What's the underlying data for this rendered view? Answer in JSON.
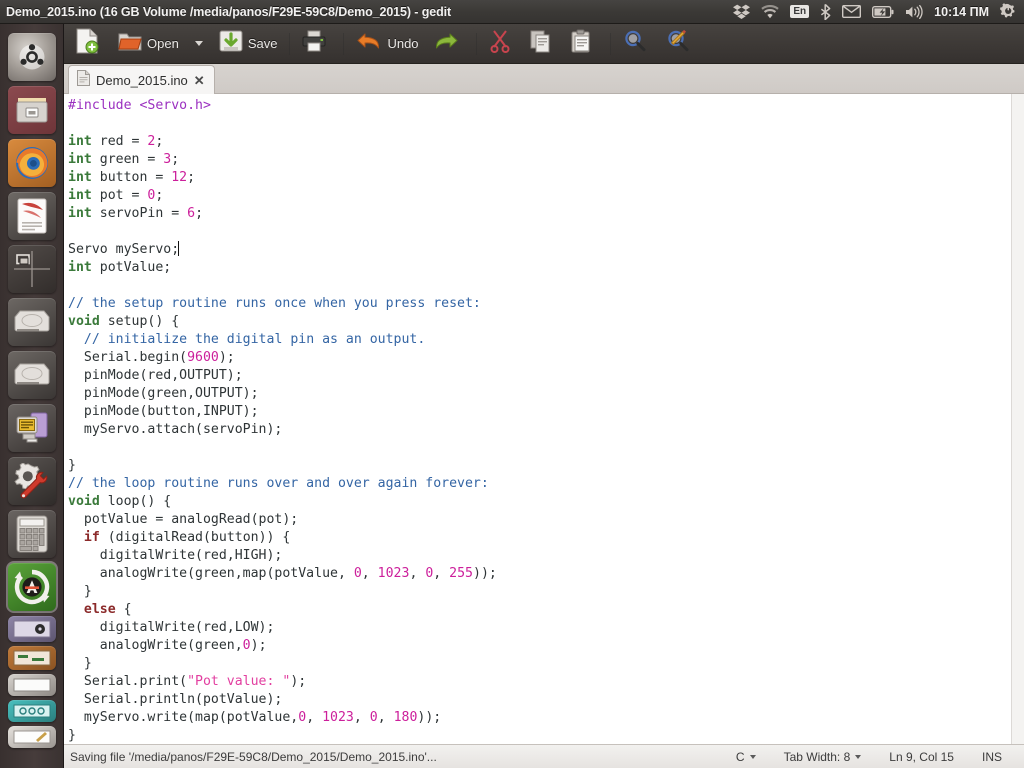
{
  "window": {
    "title": "Demo_2015.ino (16 GB Volume /media/panos/F29E-59C8/Demo_2015) - gedit"
  },
  "tray": {
    "keyboard_layout": "En",
    "clock": "10:14 ПМ",
    "icons": [
      "dropbox-icon",
      "wifi-icon",
      "keyboard-layout-indicator",
      "bluetooth-icon",
      "mail-icon",
      "battery-icon",
      "volume-icon",
      "system-menu-icon"
    ]
  },
  "launcher": {
    "items": [
      {
        "name": "ubuntu-dash",
        "label": "Dash home",
        "running": false,
        "active": false
      },
      {
        "name": "files",
        "label": "Files",
        "running": true,
        "active": false
      },
      {
        "name": "firefox",
        "label": "Firefox Web Browser",
        "running": true,
        "active": false
      },
      {
        "name": "libreoffice-writer",
        "label": "LibreOffice Writer",
        "running": false,
        "active": false
      },
      {
        "name": "workspace-switcher",
        "label": "Workspace Switcher",
        "running": false,
        "active": false
      },
      {
        "name": "disk-drive",
        "label": "Volume",
        "running": false,
        "active": false
      },
      {
        "name": "disk-drive-2",
        "label": "16 GB Volume",
        "running": false,
        "active": false
      },
      {
        "name": "software-center",
        "label": "Ubuntu Software Center",
        "running": false,
        "active": false
      },
      {
        "name": "system-settings",
        "label": "System Settings",
        "running": false,
        "active": false
      },
      {
        "name": "calculator",
        "label": "Calculator",
        "running": false,
        "active": false
      },
      {
        "name": "software-updater",
        "label": "Software Updater",
        "running": true,
        "active": true
      }
    ]
  },
  "toolbar": {
    "new_label": "",
    "open_label": "Open",
    "save_label": "Save",
    "print_label": "",
    "undo_label": "Undo",
    "redo_label": "",
    "cut_label": "",
    "copy_label": "",
    "paste_label": "",
    "find_label": "",
    "replace_label": ""
  },
  "tabs": [
    {
      "label": "Demo_2015.ino",
      "close": "✕",
      "active": true
    }
  ],
  "editor": {
    "cursor_line": 9,
    "cursor_col": 15,
    "lines": [
      [
        {
          "t": "#include <Servo.h>",
          "c": "pre"
        }
      ],
      [],
      [
        {
          "t": "int",
          "c": "kw"
        },
        {
          "t": " red = "
        },
        {
          "t": "2",
          "c": "num"
        },
        {
          "t": ";"
        }
      ],
      [
        {
          "t": "int",
          "c": "kw"
        },
        {
          "t": " green = "
        },
        {
          "t": "3",
          "c": "num"
        },
        {
          "t": ";"
        }
      ],
      [
        {
          "t": "int",
          "c": "kw"
        },
        {
          "t": " button = "
        },
        {
          "t": "12",
          "c": "num"
        },
        {
          "t": ";"
        }
      ],
      [
        {
          "t": "int",
          "c": "kw"
        },
        {
          "t": " pot = "
        },
        {
          "t": "0",
          "c": "num"
        },
        {
          "t": ";"
        }
      ],
      [
        {
          "t": "int",
          "c": "kw"
        },
        {
          "t": " servoPin = "
        },
        {
          "t": "6",
          "c": "num"
        },
        {
          "t": ";"
        }
      ],
      [],
      [
        {
          "t": "Servo myServo;"
        },
        {
          "t": "",
          "c": "caret"
        }
      ],
      [
        {
          "t": "int",
          "c": "kw"
        },
        {
          "t": " potValue;"
        }
      ],
      [],
      [
        {
          "t": "// the setup routine runs once when you press reset:",
          "c": "cmt"
        }
      ],
      [
        {
          "t": "void",
          "c": "kw"
        },
        {
          "t": " setup() {"
        }
      ],
      [
        {
          "t": "  "
        },
        {
          "t": "// initialize the digital pin as an output.",
          "c": "cmt"
        }
      ],
      [
        {
          "t": "  Serial.begin("
        },
        {
          "t": "9600",
          "c": "num"
        },
        {
          "t": ");"
        }
      ],
      [
        {
          "t": "  pinMode(red,OUTPUT);"
        }
      ],
      [
        {
          "t": "  pinMode(green,OUTPUT);"
        }
      ],
      [
        {
          "t": "  pinMode(button,INPUT);"
        }
      ],
      [
        {
          "t": "  myServo.attach(servoPin);"
        }
      ],
      [],
      [
        {
          "t": "}"
        }
      ],
      [
        {
          "t": "// the loop routine runs over and over again forever:",
          "c": "cmt"
        }
      ],
      [
        {
          "t": "void",
          "c": "kw"
        },
        {
          "t": " loop() {"
        }
      ],
      [
        {
          "t": "  potValue = analogRead(pot);"
        }
      ],
      [
        {
          "t": "  "
        },
        {
          "t": "if",
          "c": "kw2"
        },
        {
          "t": " (digitalRead(button)) {"
        }
      ],
      [
        {
          "t": "    digitalWrite(red,HIGH);"
        }
      ],
      [
        {
          "t": "    analogWrite(green,map(potValue, "
        },
        {
          "t": "0",
          "c": "num"
        },
        {
          "t": ", "
        },
        {
          "t": "1023",
          "c": "num"
        },
        {
          "t": ", "
        },
        {
          "t": "0",
          "c": "num"
        },
        {
          "t": ", "
        },
        {
          "t": "255",
          "c": "num"
        },
        {
          "t": "));"
        }
      ],
      [
        {
          "t": "  }"
        }
      ],
      [
        {
          "t": "  "
        },
        {
          "t": "else",
          "c": "kw2"
        },
        {
          "t": " {"
        }
      ],
      [
        {
          "t": "    digitalWrite(red,LOW);"
        }
      ],
      [
        {
          "t": "    analogWrite(green,"
        },
        {
          "t": "0",
          "c": "num"
        },
        {
          "t": ");"
        }
      ],
      [
        {
          "t": "  }"
        }
      ],
      [
        {
          "t": "  Serial.print("
        },
        {
          "t": "\"Pot value: \"",
          "c": "str"
        },
        {
          "t": ");"
        }
      ],
      [
        {
          "t": "  Serial.println(potValue);"
        }
      ],
      [
        {
          "t": "  myServo.write(map(potValue,"
        },
        {
          "t": "0",
          "c": "num"
        },
        {
          "t": ", "
        },
        {
          "t": "1023",
          "c": "num"
        },
        {
          "t": ", "
        },
        {
          "t": "0",
          "c": "num"
        },
        {
          "t": ", "
        },
        {
          "t": "180",
          "c": "num"
        },
        {
          "t": "));"
        }
      ],
      [
        {
          "t": "}"
        }
      ]
    ]
  },
  "statusbar": {
    "message": "Saving file '/media/panos/F29E-59C8/Demo_2015/Demo_2015.ino'...",
    "language": "C",
    "tab_width": "Tab Width: 8",
    "position": "Ln 9, Col 15",
    "insert_mode": "INS"
  },
  "colors": {
    "panel": "#3b3936",
    "editor_bg": "#ffffff",
    "keyword": "#3b7a3b",
    "control_keyword": "#8b2a2a",
    "preprocessor": "#9b30c0",
    "number": "#cc1f9b",
    "string": "#e23fa0",
    "comment": "#3465a4",
    "text": "#2e3436"
  }
}
